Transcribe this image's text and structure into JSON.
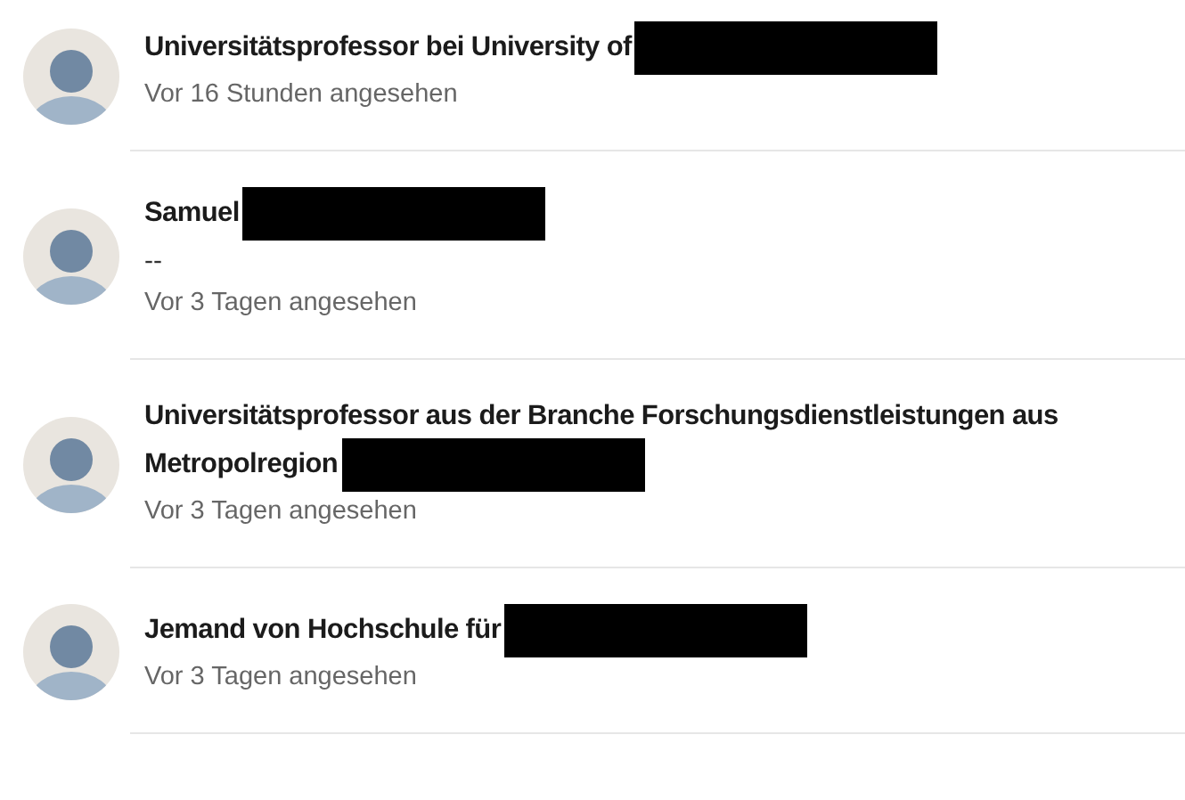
{
  "viewers": [
    {
      "title_lines": [
        "Universitätsprofessor bei University of"
      ],
      "redacted": true,
      "time": "Vor 16 Stunden angesehen"
    },
    {
      "title_lines": [
        "Samuel"
      ],
      "redacted": true,
      "subtitle": "--",
      "time": "Vor 3 Tagen angesehen"
    },
    {
      "title_lines": [
        "Universitätsprofessor aus der Branche Forschungsdienstleistungen aus",
        "Metropolregion"
      ],
      "redacted": true,
      "time": "Vor 3 Tagen angesehen"
    },
    {
      "title_lines": [
        "Jemand von Hochschule für"
      ],
      "redacted": true,
      "time": "Vor 3 Tagen angesehen"
    }
  ]
}
